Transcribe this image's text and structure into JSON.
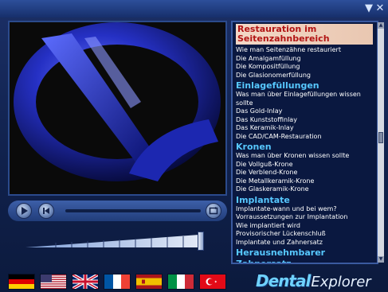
{
  "window": {
    "minimize_icon": "triangle-down",
    "close_icon": "x"
  },
  "player": {
    "buttons": [
      "play-icon",
      "rewind-icon",
      "loop-icon"
    ],
    "volume_level": 0.95
  },
  "topics": [
    {
      "type": "title",
      "text": "Restauration im Seitenzahnbereich"
    },
    {
      "type": "item",
      "text": "Wie man Seitenzähne restauriert"
    },
    {
      "type": "item",
      "text": "Die Amalgamfüllung"
    },
    {
      "type": "item",
      "text": "Die Kompositfüllung"
    },
    {
      "type": "item",
      "text": "Die Glasionomerfüllung"
    },
    {
      "type": "section",
      "text": "Einlagefüllungen"
    },
    {
      "type": "item",
      "text": "Was man über Einlagefüllungen wissen"
    },
    {
      "type": "item",
      "text": "sollte"
    },
    {
      "type": "item",
      "text": "Das Gold-Inlay"
    },
    {
      "type": "item",
      "text": "Das Kunststoffinlay"
    },
    {
      "type": "item",
      "text": "Das Keramik-Inlay"
    },
    {
      "type": "item",
      "text": "Die CAD/CAM-Restauration"
    },
    {
      "type": "section",
      "text": "Kronen"
    },
    {
      "type": "item",
      "text": "Was man über Kronen wissen sollte"
    },
    {
      "type": "item",
      "text": "Die Vollguß-Krone"
    },
    {
      "type": "item",
      "text": "Die Verblend-Krone"
    },
    {
      "type": "item",
      "text": "Die Metallkeramik-Krone"
    },
    {
      "type": "item",
      "text": "Die Glaskeramik-Krone"
    },
    {
      "type": "section",
      "text": "Implantate"
    },
    {
      "type": "item",
      "text": "Implantate-wann und bei wem?"
    },
    {
      "type": "item",
      "text": "Vorraussetzungen zur Implantation"
    },
    {
      "type": "item",
      "text": "Wie implantiert wird"
    },
    {
      "type": "item",
      "text": "Provisorischer Lückenschluß"
    },
    {
      "type": "item",
      "text": "Implantate und Zahnersatz"
    },
    {
      "type": "section",
      "text": "Herausnehmbarer"
    },
    {
      "type": "section",
      "text": "Zahnersatz"
    }
  ],
  "flags": [
    {
      "name": "flag-germany"
    },
    {
      "name": "flag-usa"
    },
    {
      "name": "flag-uk"
    },
    {
      "name": "flag-france"
    },
    {
      "name": "flag-spain"
    },
    {
      "name": "flag-italy"
    },
    {
      "name": "flag-turkey"
    }
  ],
  "logo": {
    "part1": "Dental",
    "part2": "Explorer"
  },
  "colors": {
    "title_bg": "#f3d7c6",
    "title_text": "#b21414",
    "section_text": "#57c8ff",
    "item_text": "#ffffff"
  }
}
